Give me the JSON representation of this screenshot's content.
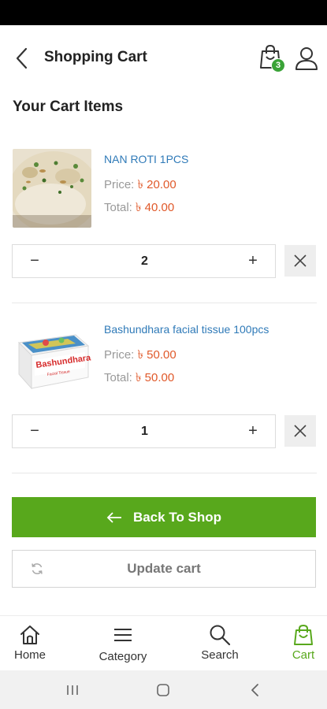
{
  "header": {
    "title": "Shopping Cart",
    "cart_count": "3"
  },
  "section_title": "Your Cart Items",
  "currency_symbol": "৳",
  "cart_items": [
    {
      "name": "NAN ROTI 1PCS",
      "price_label": "Price:",
      "price": "৳ 20.00",
      "total_label": "Total:",
      "total": "৳ 40.00",
      "quantity": "2",
      "minus": "−",
      "plus": "+"
    },
    {
      "name": "Bashundhara facial tissue 100pcs",
      "price_label": "Price:",
      "price": "৳ 50.00",
      "total_label": "Total:",
      "total": "৳ 50.00",
      "quantity": "1",
      "minus": "−",
      "plus": "+",
      "image_text": "Bashundhara",
      "image_subtext": "Facial Tissue"
    }
  ],
  "actions": {
    "back_to_shop": "Back To Shop",
    "update_cart": "Update cart"
  },
  "bottom_nav": [
    {
      "label": "Home",
      "icon": "home-icon"
    },
    {
      "label": "Category",
      "icon": "menu-icon"
    },
    {
      "label": "Search",
      "icon": "search-icon"
    },
    {
      "label": "Cart",
      "icon": "cart-icon",
      "active": true
    }
  ],
  "colors": {
    "accent_green": "#58a81c",
    "price_orange": "#e0592a",
    "link_blue": "#2f7ab8"
  }
}
